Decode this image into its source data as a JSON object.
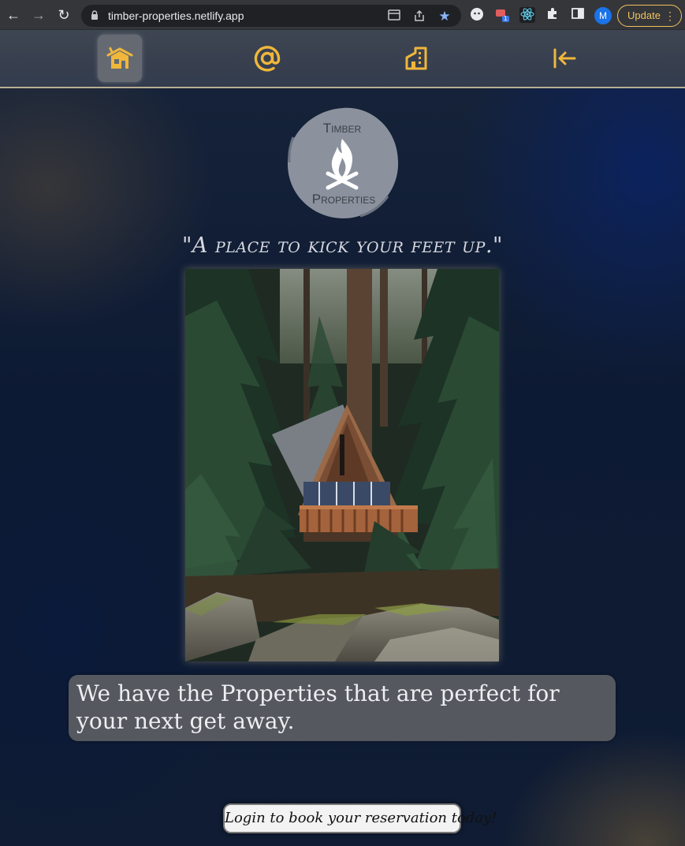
{
  "browser": {
    "url": "timber-properties.netlify.app",
    "profile_initial": "M",
    "update_label": "Update",
    "ext_badge_count": "1"
  },
  "nav": {
    "items": [
      {
        "name": "home",
        "icon": "house-icon"
      },
      {
        "name": "contact",
        "icon": "at-sign-icon"
      },
      {
        "name": "properties",
        "icon": "building-icon"
      },
      {
        "name": "logout",
        "icon": "arrow-left-bar-icon"
      }
    ],
    "active": "home"
  },
  "logo": {
    "line1": "Timber",
    "line2": "Properties"
  },
  "tagline": "\"A place to kick your feet up.\"",
  "hero_image": "a-frame-cabin-in-forest",
  "pitch": "We have the Properties that are perfect for your next get away.",
  "cta_label": "Login to book your reservation today!",
  "colors": {
    "accent": "#f0b73a",
    "nav_bg": "#3a4250",
    "nav_border": "#b7ae92",
    "page_bg": "#0e1a30",
    "pitch_bg": "#55585e"
  }
}
